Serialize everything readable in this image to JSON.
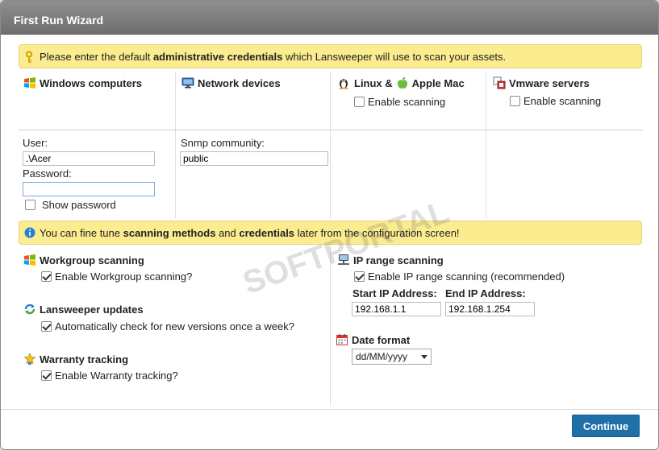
{
  "window": {
    "title": "First Run Wizard"
  },
  "banner1": {
    "pre": "Please enter the default ",
    "bold": "administrative credentials",
    "post": " which Lansweeper will use to scan your assets."
  },
  "columns": {
    "windows": {
      "title": "Windows computers"
    },
    "network": {
      "title": "Network devices"
    },
    "linux": {
      "title_a": "Linux &",
      "title_b": "Apple Mac",
      "enable_label": "Enable scanning",
      "enabled": false
    },
    "vmware": {
      "title": "Vmware servers",
      "enable_label": "Enable scanning",
      "enabled": false
    }
  },
  "credentials": {
    "user_label": "User:",
    "user_value": ".\\Acer",
    "password_label": "Password:",
    "password_value": "",
    "show_password_label": "Show password",
    "show_password": false,
    "snmp_label": "Snmp community:",
    "snmp_value": "public"
  },
  "banner2": {
    "pre": "You can fine tune ",
    "bold1": "scanning methods",
    "mid": " and ",
    "bold2": "credentials",
    "post": " later from the configuration screen!"
  },
  "options": {
    "workgroup": {
      "title": "Workgroup scanning",
      "check_label": "Enable Workgroup scanning?",
      "checked": true
    },
    "updates": {
      "title": "Lansweeper updates",
      "check_label": "Automatically check for new versions once a week?",
      "checked": true
    },
    "warranty": {
      "title": "Warranty tracking",
      "check_label": "Enable Warranty tracking?",
      "checked": true
    },
    "iprange": {
      "title": "IP range scanning",
      "check_label": "Enable IP range scanning (recommended)",
      "checked": true,
      "start_label": "Start IP Address:",
      "end_label": "End IP Address:",
      "start_value": "192.168.1.1",
      "end_value": "192.168.1.254"
    },
    "dateformat": {
      "title": "Date format",
      "value": "dd/MM/yyyy"
    }
  },
  "footer": {
    "continue_label": "Continue"
  },
  "watermark": {
    "text": "SOFTPORTAL"
  },
  "colors": {
    "banner": "#fbec8f",
    "button": "#1f6fa8",
    "titlebar": "#7d7d7d"
  }
}
